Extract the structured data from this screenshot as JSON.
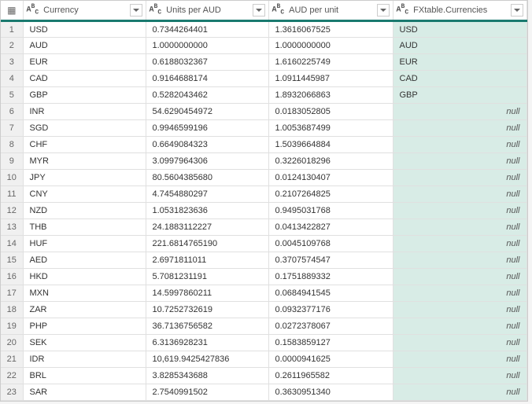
{
  "columns": {
    "c1": "Currency",
    "c2": "Units per AUD",
    "c3": "AUD per unit",
    "c4": "FXtable.Currencies"
  },
  "rows": [
    {
      "n": "1",
      "currency": "USD",
      "units": "0.7344264401",
      "aud": "1.3616067525",
      "fx": "USD"
    },
    {
      "n": "2",
      "currency": "AUD",
      "units": "1.0000000000",
      "aud": "1.0000000000",
      "fx": "AUD"
    },
    {
      "n": "3",
      "currency": "EUR",
      "units": "0.6188032367",
      "aud": "1.6160225749",
      "fx": "EUR"
    },
    {
      "n": "4",
      "currency": "CAD",
      "units": "0.9164688174",
      "aud": "1.0911445987",
      "fx": "CAD"
    },
    {
      "n": "5",
      "currency": "GBP",
      "units": "0.5282043462",
      "aud": "1.8932066863",
      "fx": "GBP"
    },
    {
      "n": "6",
      "currency": "INR",
      "units": "54.6290454972",
      "aud": "0.0183052805",
      "fx": null
    },
    {
      "n": "7",
      "currency": "SGD",
      "units": "0.9946599196",
      "aud": "1.0053687499",
      "fx": null
    },
    {
      "n": "8",
      "currency": "CHF",
      "units": "0.6649084323",
      "aud": "1.5039664884",
      "fx": null
    },
    {
      "n": "9",
      "currency": "MYR",
      "units": "3.0997964306",
      "aud": "0.3226018296",
      "fx": null
    },
    {
      "n": "10",
      "currency": "JPY",
      "units": "80.5604385680",
      "aud": "0.0124130407",
      "fx": null
    },
    {
      "n": "11",
      "currency": "CNY",
      "units": "4.7454880297",
      "aud": "0.2107264825",
      "fx": null
    },
    {
      "n": "12",
      "currency": "NZD",
      "units": "1.0531823636",
      "aud": "0.9495031768",
      "fx": null
    },
    {
      "n": "13",
      "currency": "THB",
      "units": "24.1883112227",
      "aud": "0.0413422827",
      "fx": null
    },
    {
      "n": "14",
      "currency": "HUF",
      "units": "221.6814765190",
      "aud": "0.0045109768",
      "fx": null
    },
    {
      "n": "15",
      "currency": "AED",
      "units": "2.6971811011",
      "aud": "0.3707574547",
      "fx": null
    },
    {
      "n": "16",
      "currency": "HKD",
      "units": "5.7081231191",
      "aud": "0.1751889332",
      "fx": null
    },
    {
      "n": "17",
      "currency": "MXN",
      "units": "14.5997860211",
      "aud": "0.0684941545",
      "fx": null
    },
    {
      "n": "18",
      "currency": "ZAR",
      "units": "10.7252732619",
      "aud": "0.0932377176",
      "fx": null
    },
    {
      "n": "19",
      "currency": "PHP",
      "units": "36.7136756582",
      "aud": "0.0272378067",
      "fx": null
    },
    {
      "n": "20",
      "currency": "SEK",
      "units": "6.3136928231",
      "aud": "0.1583859127",
      "fx": null
    },
    {
      "n": "21",
      "currency": "IDR",
      "units": "10,619.9425427836",
      "aud": "0.0000941625",
      "fx": null
    },
    {
      "n": "22",
      "currency": "BRL",
      "units": "3.8285343688",
      "aud": "0.2611965582",
      "fx": null
    },
    {
      "n": "23",
      "currency": "SAR",
      "units": "2.7540991502",
      "aud": "0.3630951340",
      "fx": null
    }
  ],
  "null_label": "null"
}
